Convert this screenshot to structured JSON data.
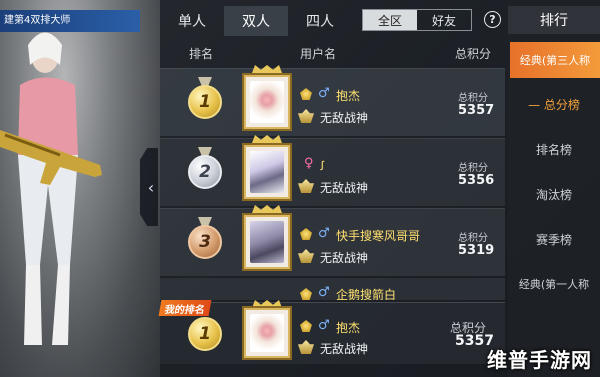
{
  "banner": {
    "text": "建第4双排大师"
  },
  "tabs": [
    {
      "label": "单人"
    },
    {
      "label": "双人"
    },
    {
      "label": "四人"
    }
  ],
  "scope": {
    "all": "全区",
    "friends": "好友"
  },
  "help_icon": "?",
  "columns": {
    "rank": "排名",
    "user": "用户名",
    "points": "总积分"
  },
  "rows": [
    {
      "rank": "1",
      "gender_icon": "♂",
      "name": "抱杰",
      "title": "无敌战神",
      "points_label": "总积分",
      "points": "5357"
    },
    {
      "rank": "2",
      "gender_icon": "♀",
      "name": "ꭍ",
      "title": "无敌战神",
      "points_label": "总积分",
      "points": "5356"
    },
    {
      "rank": "3",
      "gender_icon": "♂",
      "name": "快手搜寒风哥哥",
      "title": "无敌战神",
      "points_label": "总积分",
      "points": "5319"
    }
  ],
  "peek_row": {
    "gender_icon": "♂",
    "name": "企鹅搜箭白"
  },
  "my_rank": {
    "label": "我的排名",
    "rank": "1",
    "gender_icon": "♂",
    "name": "抱杰",
    "title": "无敌战神",
    "points_label": "总积分",
    "points": "5357"
  },
  "sidebar": {
    "title": "排行",
    "items": [
      {
        "label": "经典(第三人称"
      },
      {
        "label": "总分榜"
      },
      {
        "label": "排名榜"
      },
      {
        "label": "淘汰榜"
      },
      {
        "label": "赛季榜"
      },
      {
        "label": "经典(第一人称"
      }
    ]
  },
  "watermark": "维普手游网",
  "colors": {
    "accent": "#f39b3b",
    "gold": "#e7c24a",
    "name": "#ffe070"
  }
}
